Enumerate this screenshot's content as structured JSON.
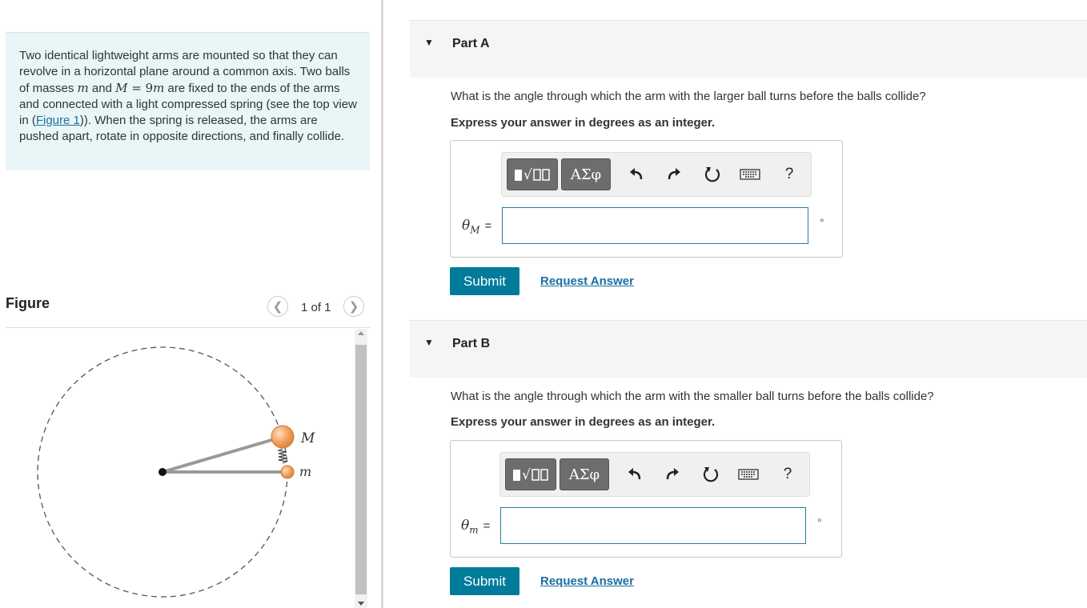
{
  "problem": {
    "text_1": "Two identical lightweight arms are mounted so that they can revolve in a horizontal plane around a common axis. Two balls of masses ",
    "m": "m",
    "and": " and ",
    "M": "M",
    "eq": " = 9",
    "m2": "m",
    "text_2": " are fixed to the ends of the arms and connected with a light compressed spring (see the top view in (",
    "figure_link": "Figure 1",
    "text_3": ")). When the spring is released, the arms are pushed apart, rotate in opposite directions, and finally collide."
  },
  "figure": {
    "title": "Figure",
    "pager": "1 of 1",
    "prev_icon": "chevron-left-icon",
    "next_icon": "chevron-right-icon",
    "label_M": "M",
    "label_m": "m",
    "colors": {
      "ball": "#f4a460",
      "arm": "#bbbbbb",
      "circle": "#555555"
    }
  },
  "parts": [
    {
      "title": "Part A",
      "question": "What is the angle through which the arm with the larger ball turns before the balls collide?",
      "instruction": "Express your answer in degrees as an integer.",
      "var_main": "θ",
      "var_sub": "M",
      "eq": "=",
      "value": "",
      "unit": "°",
      "submit": "Submit",
      "request": "Request Answer"
    },
    {
      "title": "Part B",
      "question": "What is the angle through which the arm with the smaller ball turns before the balls collide?",
      "instruction": "Express your answer in degrees as an integer.",
      "var_main": "θ",
      "var_sub": "m",
      "eq": "=",
      "value": "",
      "unit": "°",
      "submit": "Submit",
      "request": "Request Answer"
    }
  ],
  "toolbar": {
    "greek_label": "ΑΣφ",
    "help_label": "?",
    "icons": [
      "templates-icon",
      "greek-icon",
      "undo-icon",
      "redo-icon",
      "reset-icon",
      "keyboard-icon",
      "help-icon"
    ]
  },
  "accent": "#007c9a"
}
